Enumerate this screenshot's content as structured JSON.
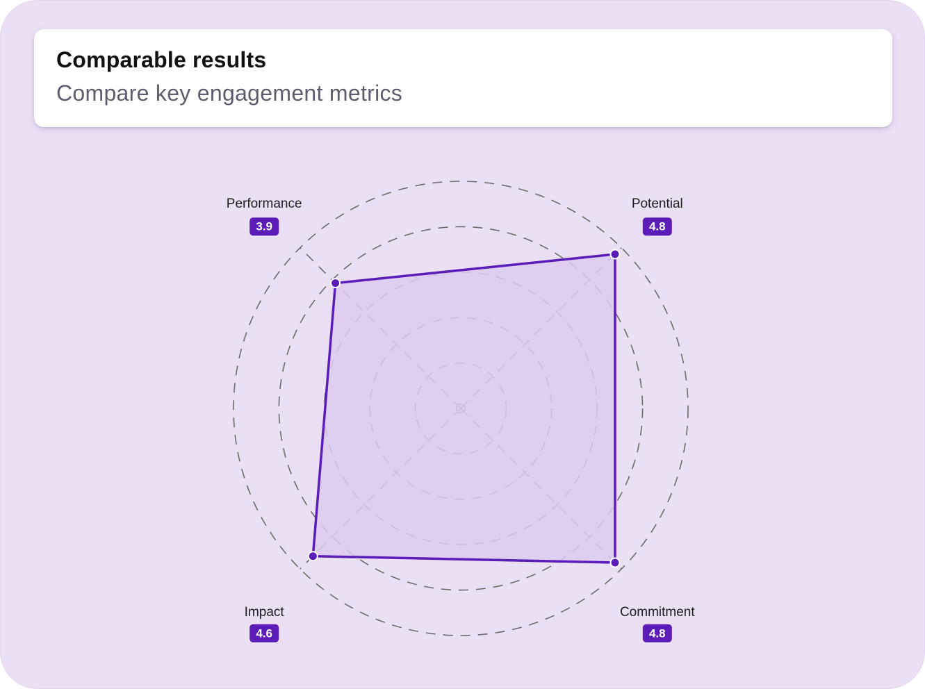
{
  "header": {
    "title": "Comparable results",
    "subtitle": "Compare key engagement metrics"
  },
  "colors": {
    "background": "#ebdff4",
    "accent": "#5b1cb7",
    "fill": "#dccbef",
    "grid": "#6b6b6b"
  },
  "chart_data": {
    "type": "radar",
    "max": 5,
    "rings": 5,
    "grid": true,
    "axes": [
      {
        "label": "Performance",
        "value": 3.9,
        "value_label": "3.9"
      },
      {
        "label": "Potential",
        "value": 4.8,
        "value_label": "4.8"
      },
      {
        "label": "Commitment",
        "value": 4.8,
        "value_label": "4.8"
      },
      {
        "label": "Impact",
        "value": 4.6,
        "value_label": "4.6"
      }
    ]
  }
}
